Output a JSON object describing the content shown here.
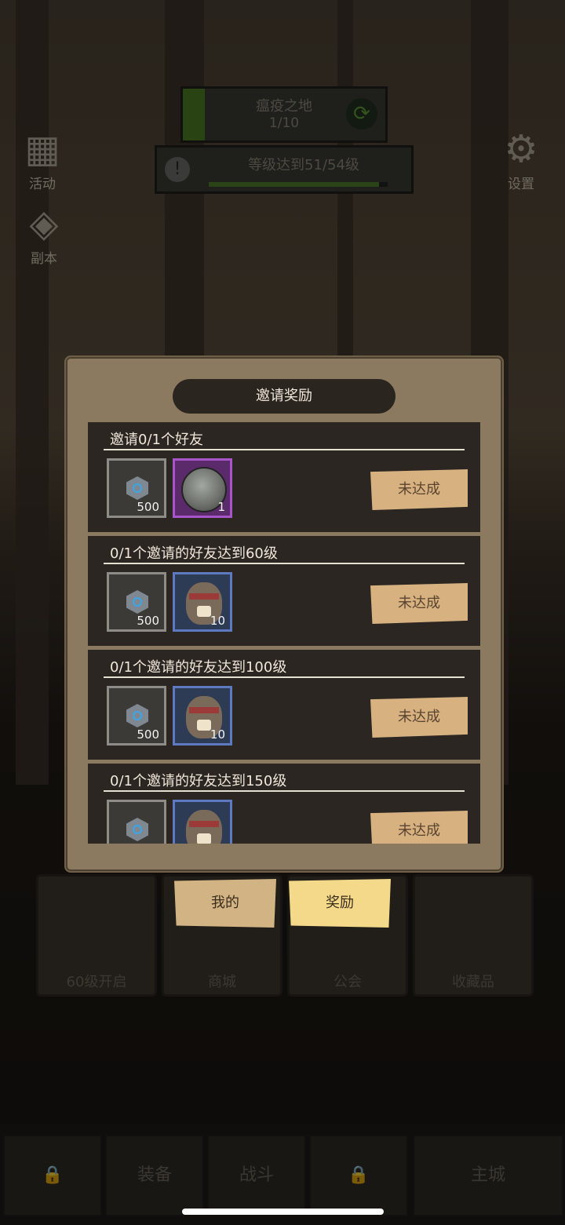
{
  "hud": {
    "zone_name": "瘟疫之地",
    "zone_progress": "1/10",
    "quest_text": "等级达到51/54级",
    "quest_progress": 0.95
  },
  "side_icons": {
    "activity_label": "活动",
    "dungeon_label": "副本",
    "settings_label": "设置"
  },
  "menu_cards": [
    "60级开启",
    "商城",
    "公会",
    "收藏品"
  ],
  "tabs": {
    "mine": "我的",
    "reward": "奖励"
  },
  "bottom_nav": {
    "equip": "装备",
    "battle": "战斗",
    "main_city": "主城"
  },
  "panel": {
    "title": "邀请奖励",
    "rows": [
      {
        "title": "邀请0/1个好友",
        "item1_count": "500",
        "item2_count": "1",
        "status": "未达成"
      },
      {
        "title": "0/1个邀请的好友达到60级",
        "item1_count": "500",
        "item2_count": "10",
        "status": "未达成"
      },
      {
        "title": "0/1个邀请的好友达到100级",
        "item1_count": "500",
        "item2_count": "10",
        "status": "未达成"
      },
      {
        "title": "0/1个邀请的好友达到150级",
        "item1_count": "",
        "item2_count": "",
        "status": "未达成"
      }
    ]
  },
  "colors": {
    "panel": "#8c7a60",
    "row": "#2b2622",
    "status_button": "#d7b180",
    "reward_tab": "#f4d98a"
  }
}
